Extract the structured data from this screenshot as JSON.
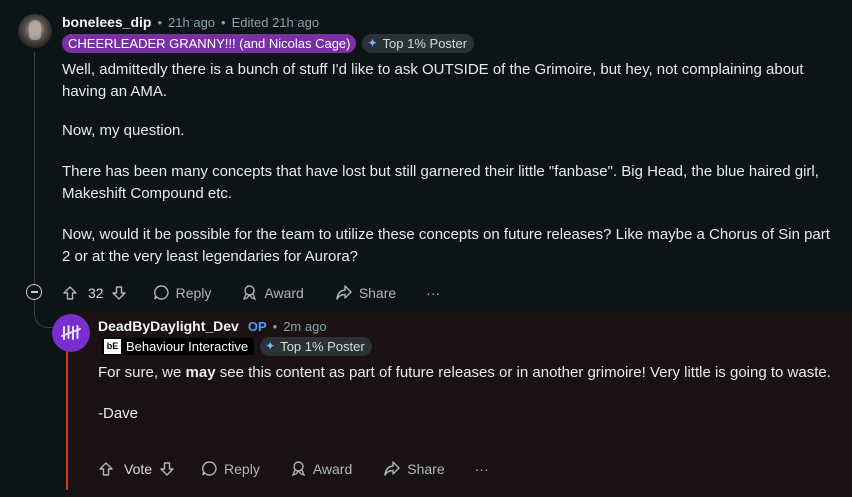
{
  "parent": {
    "username": "bonelees_dip",
    "time": "21h ago",
    "edited": "Edited 21h ago",
    "flair": "CHEERLEADER GRANNY!!! (and Nicolas Cage)",
    "badge": "Top 1% Poster",
    "paragraphs": [
      "Well, admittedly there is a bunch of stuff I'd like to ask OUTSIDE of the Grimoire, but hey, not complaining about having an AMA.",
      "Now, my question.",
      "There has been many concepts that have lost but still garnered their little \"fanbase\". Big Head, the blue haired girl, Makeshift Compound etc.",
      "Now, would it be possible for the team to utilize these concepts on future releases? Like maybe a Chorus of Sin part 2 or at the very least legendaries for Aurora?"
    ],
    "actions": {
      "vote_count": "32",
      "reply": "Reply",
      "award": "Award",
      "share": "Share",
      "more": "···"
    }
  },
  "reply": {
    "username": "DeadByDaylight_Dev",
    "op": "OP",
    "time": "2m ago",
    "flair": "Behaviour Interactive",
    "flair_logo": "bE",
    "badge": "Top 1% Poster",
    "text_before": "For sure, we ",
    "text_bold": "may",
    "text_after": " see this content as part of future releases or in another grimoire! Very little is going to waste.",
    "signature": "-Dave",
    "actions": {
      "vote": "Vote",
      "reply": "Reply",
      "award": "Award",
      "share": "Share",
      "more": "···"
    }
  },
  "colors": {
    "background": "#0b1416",
    "flair_purple": "#7a2fa5",
    "op_blue": "#4f9dff",
    "reply_accent": "#d63b1f",
    "avatar_purple": "#7b2ecf"
  }
}
